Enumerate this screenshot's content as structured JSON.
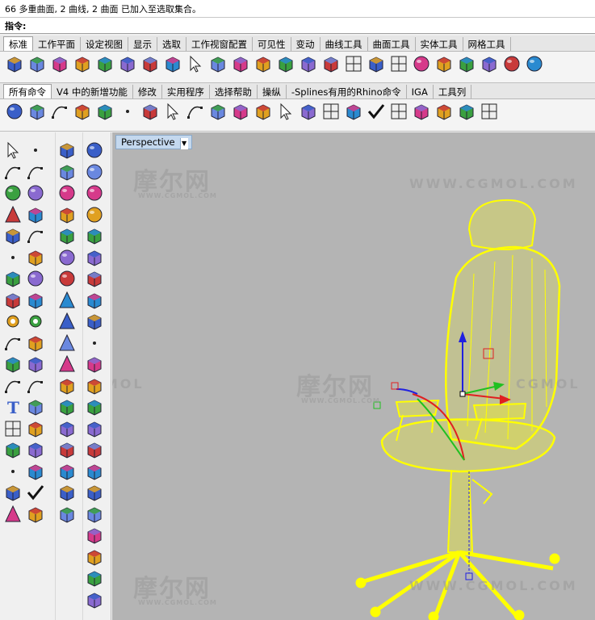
{
  "command": {
    "history": "66 多重曲面, 2 曲线, 2 曲面 已加入至选取集合。",
    "prompt": "指令:"
  },
  "tabs_standard": [
    "标准",
    "工作平面",
    "设定视图",
    "显示",
    "选取",
    "工作视窗配置",
    "可见性",
    "变动",
    "曲线工具",
    "曲面工具",
    "实体工具",
    "网格工具"
  ],
  "tabs_commands": [
    "所有命令",
    "V4 中的新增功能",
    "修改",
    "实用程序",
    "选择帮助",
    "操纵",
    "-Splines有用的Rhino命令",
    "IGA",
    "工具列"
  ],
  "toolbar_standard_icons": [
    "new-file-icon",
    "open-folder-icon",
    "save-icon",
    "print-icon",
    "import-icon",
    "cut-icon",
    "copy-icon",
    "paste-icon",
    "undo-icon",
    "pan-hand-icon",
    "move-view-icon",
    "zoom-icon",
    "zoom-window-icon",
    "zoom-extents-icon",
    "rotate-view-icon",
    "four-viewports-icon",
    "car-render-icon",
    "grid-icon",
    "circle-snap-icon",
    "lock-icon",
    "light-bulb-icon",
    "layer-icon",
    "color-wheel-icon",
    "sphere-render-icon"
  ],
  "toolbar_command_icons": [
    "power-icon",
    "box-icon",
    "curve-cube-icon",
    "array-icon",
    "box-edit-icon",
    "points-icon",
    "pipe-icon",
    "box-arrow-icon",
    "arch-icon",
    "box-align-icon",
    "surface-icon",
    "cube-split-icon",
    "arrow-down-icon",
    "box-cut-icon",
    "grid-box-icon",
    "box-pink-icon",
    "checkbox-icon",
    "grid-red-icon",
    "box-move-icon",
    "x-box-icon",
    "bracket-icon",
    "grid-multi-icon"
  ],
  "palette_col1": [
    "select-arrow-icon",
    "point-icon",
    "polyline-icon",
    "curve-icon",
    "circle-icon",
    "ellipse-icon",
    "polygon-icon",
    "rectangle-icon",
    "hexagon-icon",
    "arc-icon",
    "surface-point-icon",
    "surface-edge-icon",
    "box-solid-icon",
    "sphere-solid-icon",
    "cylinder-solid-icon",
    "mesh-surface-icon",
    "gear-icon",
    "explode-icon",
    "line-split-icon",
    "trim-icon",
    "boolean-icon",
    "group-icon",
    "fillet-icon",
    "blend-icon",
    "text-icon",
    "dimension-icon",
    "array-grid-icon",
    "mirror-icon",
    "block-icon",
    "wrench-icon",
    "grid-dots-icon",
    "arrange-icon",
    "cut-plane-icon",
    "check-icon",
    "cone-icon",
    "material-icon"
  ],
  "palette_col2": [
    "cube-icon",
    "cylinder-icon",
    "sphere-icon",
    "ellipsoid-icon",
    "paraboloid-icon",
    "dome-icon",
    "half-sphere-icon",
    "truncated-cone-icon",
    "cone-shape-icon",
    "pyramid-icon",
    "tetrahedron-icon",
    "wedge-icon",
    "tube-icon",
    "torus-icon",
    "pipe-bend-icon",
    "revolve-icon",
    "sweep-icon",
    "patch-icon"
  ],
  "palette_col3": [
    "sphere-union-icon",
    "sphere-diff-icon",
    "sphere-intersect-icon",
    "sphere-split-icon",
    "box-shell-icon",
    "polyhedron-icon",
    "box-cap-icon",
    "layers-icon",
    "box-stack-icon",
    "dots-cluster-icon",
    "box-flat-icon",
    "box-small-icon",
    "slab-icon",
    "extrude-icon",
    "box-extrude-icon",
    "box-open-icon",
    "box-tag-icon",
    "box-face-icon",
    "box-corner-icon",
    "box-edge-icon",
    "box-round-icon",
    "box-last-icon"
  ],
  "viewport": {
    "name": "Perspective",
    "watermark_cn": "摩尔网",
    "watermark_url": "WWW.CGMOL.COM",
    "watermark_en": "CGMOL"
  },
  "colors": {
    "viewport_bg": "#b4b4b4",
    "wireframe": "#ffff00",
    "axis_x": "#e02020",
    "axis_y": "#20c020",
    "axis_z": "#2020e0"
  }
}
